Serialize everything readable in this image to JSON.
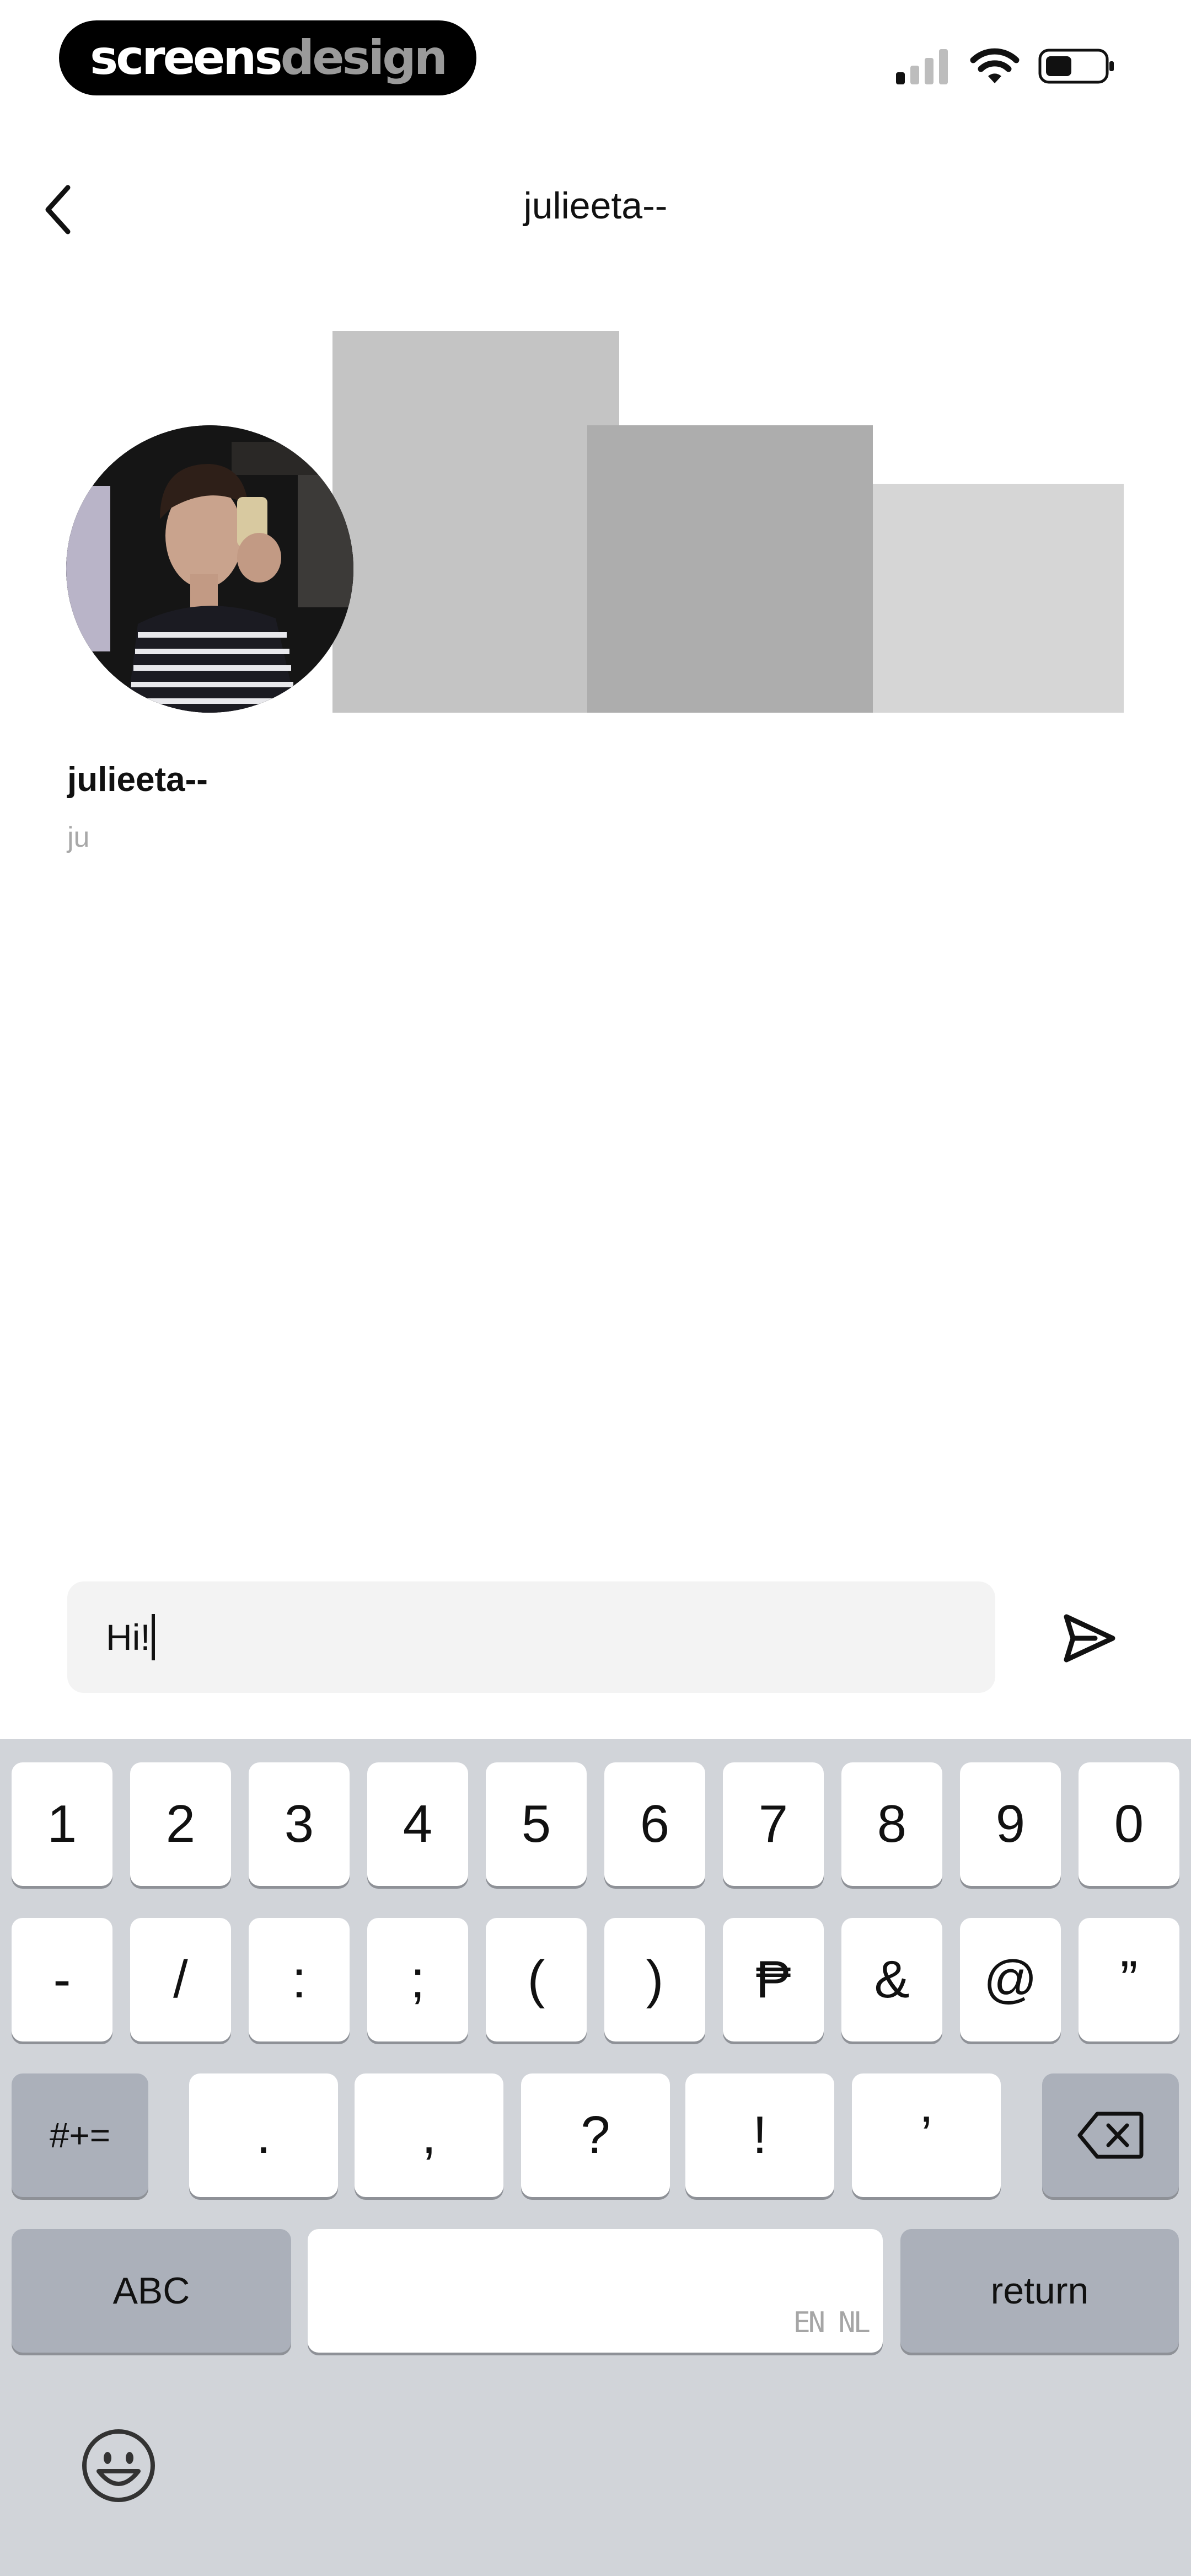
{
  "status_bar": {
    "brand_primary": "screens",
    "brand_secondary": "design",
    "signal_icon": "signal-icon",
    "wifi_icon": "wifi-icon",
    "battery_icon": "battery-icon"
  },
  "nav": {
    "back_icon": "chevron-left-icon",
    "title": "julieeta--"
  },
  "profile": {
    "name": "julieeta--",
    "subtitle": "ju"
  },
  "composer": {
    "value": "Hi!",
    "send_icon": "send-icon"
  },
  "keyboard": {
    "row1": [
      "1",
      "2",
      "3",
      "4",
      "5",
      "6",
      "7",
      "8",
      "9",
      "0"
    ],
    "row2": [
      "-",
      "/",
      ":",
      ";",
      "(",
      ")",
      "₱",
      "&",
      "@",
      "”"
    ],
    "row3_mode": "#+=",
    "row3": [
      ".",
      ",",
      "?",
      "!",
      "’"
    ],
    "backspace_icon": "backspace-icon",
    "abc_label": "ABC",
    "space_hint": "EN NL",
    "return_label": "return",
    "emoji_icon": "emoji-icon"
  },
  "colors": {
    "keyboard_bg": "#d1d4d9",
    "key_dark": "#abb0ba",
    "composer_bg": "#f3f3f3"
  }
}
